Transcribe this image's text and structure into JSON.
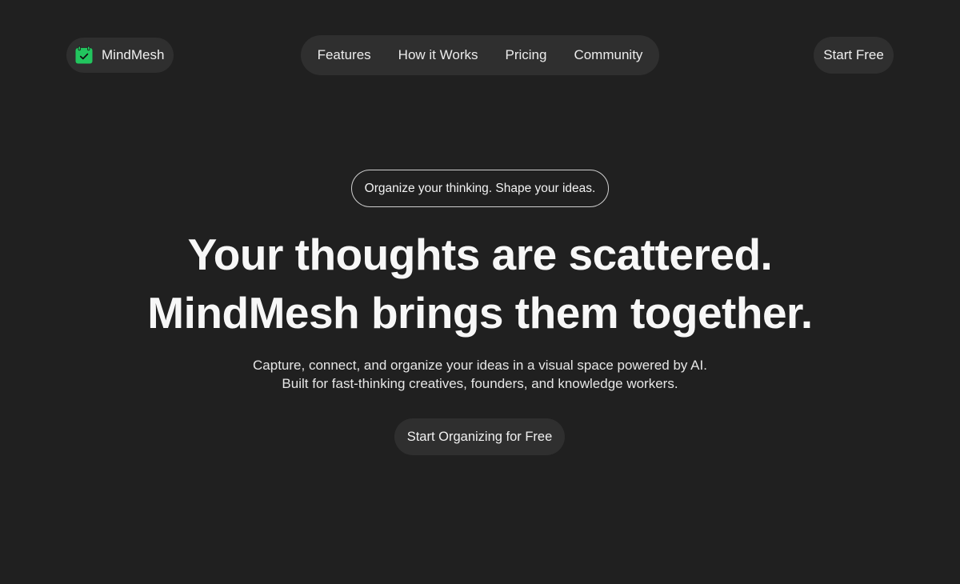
{
  "brand": {
    "name": "MindMesh",
    "icon": "calendar-check-icon",
    "icon_color": "#22c55e"
  },
  "nav": {
    "items": [
      {
        "label": "Features"
      },
      {
        "label": "How it Works"
      },
      {
        "label": "Pricing"
      },
      {
        "label": "Community"
      }
    ]
  },
  "header": {
    "cta_label": "Start Free"
  },
  "hero": {
    "tagline": "Organize your thinking. Shape your ideas.",
    "headline_line1": "Your thoughts are scattered.",
    "headline_line2": "MindMesh brings them together.",
    "subtext_line1": "Capture, connect, and organize your ideas in a visual space powered by AI.",
    "subtext_line2": "Built for fast-thinking creatives, founders, and knowledge workers.",
    "cta_label": "Start Organizing for Free"
  },
  "colors": {
    "background": "#202020",
    "pill": "#2f2f2f",
    "text": "#f2f2f2"
  }
}
